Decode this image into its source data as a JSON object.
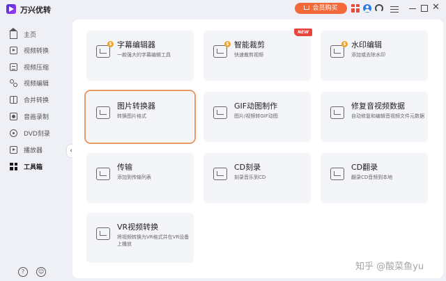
{
  "app": {
    "title": "万兴优转",
    "buy_label": "会员购买"
  },
  "sidebar": {
    "items": [
      {
        "label": "主页",
        "icon": "home-icon"
      },
      {
        "label": "视频转换",
        "icon": "video-convert-icon"
      },
      {
        "label": "视频压缩",
        "icon": "video-compress-icon"
      },
      {
        "label": "视频编辑",
        "icon": "scissors-icon"
      },
      {
        "label": "合并转换",
        "icon": "merge-icon"
      },
      {
        "label": "音画录制",
        "icon": "record-icon"
      },
      {
        "label": "DVD刻录",
        "icon": "dvd-icon"
      },
      {
        "label": "播放器",
        "icon": "player-icon"
      },
      {
        "label": "工具箱",
        "icon": "toolbox-icon"
      }
    ],
    "active": "工具箱",
    "help_glyph": "?",
    "feedback_glyph": "☺"
  },
  "tools": [
    {
      "title": "字幕编辑器",
      "desc": "一款强大的字幕编辑工具",
      "premium": true
    },
    {
      "title": "智能裁剪",
      "desc": "快速裁剪视频",
      "premium": true,
      "badge": "NEW"
    },
    {
      "title": "水印编辑",
      "desc": "添加或去除水印",
      "premium": true
    },
    {
      "title": "图片转换器",
      "desc": "转换图片格式",
      "premium": false
    },
    {
      "title": "GIF动图制作",
      "desc": "图片/视频转GIF动图",
      "premium": false
    },
    {
      "title": "修复音视频数据",
      "desc": "自动修复和编辑音视频文件元数据",
      "premium": false
    },
    {
      "title": "传输",
      "desc": "添加到传输列表",
      "premium": false
    },
    {
      "title": "CD刻录",
      "desc": "刻录音乐到CD",
      "premium": false
    },
    {
      "title": "CD翻录",
      "desc": "翻录CD音频到本地",
      "premium": false
    },
    {
      "title": "VR视频转换",
      "desc": "将视频转换为VR格式并在VR设备上播放",
      "premium": false
    }
  ],
  "coin_glyph": "$",
  "selected_tool": "图片转换器",
  "watermark": "知乎 @酸菜鱼yu",
  "colors": {
    "accent_buy": "#f26a3a",
    "badge_new": "#e8453c",
    "coin": "#f2a12e",
    "selection_outline": "#e89a64"
  }
}
